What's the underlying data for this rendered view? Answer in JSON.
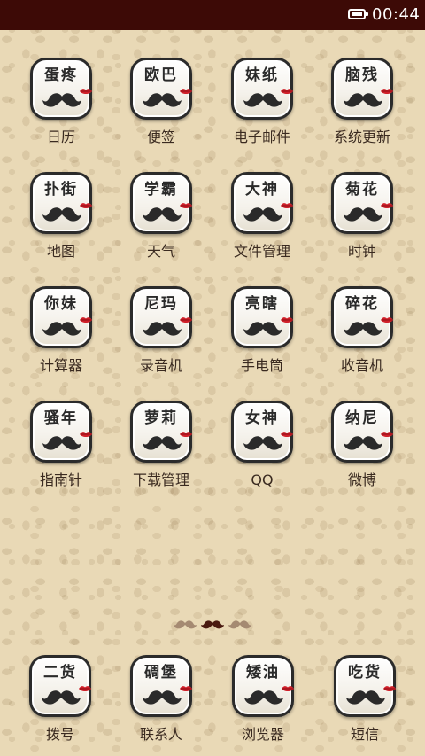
{
  "status_bar": {
    "time": "00:44",
    "battery_icon": "battery-icon"
  },
  "apps": [
    {
      "tile_text": "蛋疼",
      "label": "日历"
    },
    {
      "tile_text": "欧巴",
      "label": "便签"
    },
    {
      "tile_text": "妹纸",
      "label": "电子邮件"
    },
    {
      "tile_text": "脑残",
      "label": "系统更新"
    },
    {
      "tile_text": "扑街",
      "label": "地图"
    },
    {
      "tile_text": "学霸",
      "label": "天气"
    },
    {
      "tile_text": "大神",
      "label": "文件管理"
    },
    {
      "tile_text": "菊花",
      "label": "时钟"
    },
    {
      "tile_text": "你妹",
      "label": "计算器"
    },
    {
      "tile_text": "尼玛",
      "label": "录音机"
    },
    {
      "tile_text": "亮瞎",
      "label": "手电筒"
    },
    {
      "tile_text": "碎花",
      "label": "收音机"
    },
    {
      "tile_text": "骚年",
      "label": "指南针"
    },
    {
      "tile_text": "萝莉",
      "label": "下载管理"
    },
    {
      "tile_text": "女神",
      "label": "QQ"
    },
    {
      "tile_text": "纳尼",
      "label": "微博"
    }
  ],
  "dock": [
    {
      "tile_text": "二货",
      "label": "拨号"
    },
    {
      "tile_text": "碉堡",
      "label": "联系人"
    },
    {
      "tile_text": "矮油",
      "label": "浏览器"
    },
    {
      "tile_text": "吃货",
      "label": "短信"
    }
  ],
  "page_indicator": {
    "pages": 3,
    "current": 2
  },
  "colors": {
    "status_bar": "#3d0a06",
    "mustache": "#2a2a2a",
    "lips": "#d0202a",
    "page_dot_active": "#4a1a10",
    "page_dot_inactive": "#a58a72"
  }
}
